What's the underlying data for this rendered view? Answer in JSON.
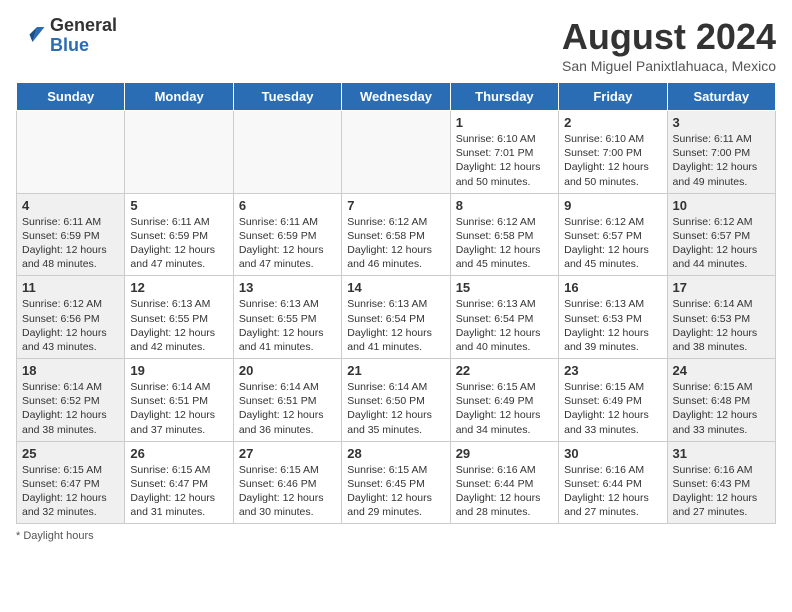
{
  "logo": {
    "general": "General",
    "blue": "Blue"
  },
  "title": "August 2024",
  "subtitle": "San Miguel Panixtlahuaca, Mexico",
  "days": [
    "Sunday",
    "Monday",
    "Tuesday",
    "Wednesday",
    "Thursday",
    "Friday",
    "Saturday"
  ],
  "weeks": [
    [
      {
        "day": "",
        "content": ""
      },
      {
        "day": "",
        "content": ""
      },
      {
        "day": "",
        "content": ""
      },
      {
        "day": "",
        "content": ""
      },
      {
        "day": "1",
        "content": "Sunrise: 6:10 AM\nSunset: 7:01 PM\nDaylight: 12 hours\nand 50 minutes."
      },
      {
        "day": "2",
        "content": "Sunrise: 6:10 AM\nSunset: 7:00 PM\nDaylight: 12 hours\nand 50 minutes."
      },
      {
        "day": "3",
        "content": "Sunrise: 6:11 AM\nSunset: 7:00 PM\nDaylight: 12 hours\nand 49 minutes."
      }
    ],
    [
      {
        "day": "4",
        "content": "Sunrise: 6:11 AM\nSunset: 6:59 PM\nDaylight: 12 hours\nand 48 minutes."
      },
      {
        "day": "5",
        "content": "Sunrise: 6:11 AM\nSunset: 6:59 PM\nDaylight: 12 hours\nand 47 minutes."
      },
      {
        "day": "6",
        "content": "Sunrise: 6:11 AM\nSunset: 6:59 PM\nDaylight: 12 hours\nand 47 minutes."
      },
      {
        "day": "7",
        "content": "Sunrise: 6:12 AM\nSunset: 6:58 PM\nDaylight: 12 hours\nand 46 minutes."
      },
      {
        "day": "8",
        "content": "Sunrise: 6:12 AM\nSunset: 6:58 PM\nDaylight: 12 hours\nand 45 minutes."
      },
      {
        "day": "9",
        "content": "Sunrise: 6:12 AM\nSunset: 6:57 PM\nDaylight: 12 hours\nand 45 minutes."
      },
      {
        "day": "10",
        "content": "Sunrise: 6:12 AM\nSunset: 6:57 PM\nDaylight: 12 hours\nand 44 minutes."
      }
    ],
    [
      {
        "day": "11",
        "content": "Sunrise: 6:12 AM\nSunset: 6:56 PM\nDaylight: 12 hours\nand 43 minutes."
      },
      {
        "day": "12",
        "content": "Sunrise: 6:13 AM\nSunset: 6:55 PM\nDaylight: 12 hours\nand 42 minutes."
      },
      {
        "day": "13",
        "content": "Sunrise: 6:13 AM\nSunset: 6:55 PM\nDaylight: 12 hours\nand 41 minutes."
      },
      {
        "day": "14",
        "content": "Sunrise: 6:13 AM\nSunset: 6:54 PM\nDaylight: 12 hours\nand 41 minutes."
      },
      {
        "day": "15",
        "content": "Sunrise: 6:13 AM\nSunset: 6:54 PM\nDaylight: 12 hours\nand 40 minutes."
      },
      {
        "day": "16",
        "content": "Sunrise: 6:13 AM\nSunset: 6:53 PM\nDaylight: 12 hours\nand 39 minutes."
      },
      {
        "day": "17",
        "content": "Sunrise: 6:14 AM\nSunset: 6:53 PM\nDaylight: 12 hours\nand 38 minutes."
      }
    ],
    [
      {
        "day": "18",
        "content": "Sunrise: 6:14 AM\nSunset: 6:52 PM\nDaylight: 12 hours\nand 38 minutes."
      },
      {
        "day": "19",
        "content": "Sunrise: 6:14 AM\nSunset: 6:51 PM\nDaylight: 12 hours\nand 37 minutes."
      },
      {
        "day": "20",
        "content": "Sunrise: 6:14 AM\nSunset: 6:51 PM\nDaylight: 12 hours\nand 36 minutes."
      },
      {
        "day": "21",
        "content": "Sunrise: 6:14 AM\nSunset: 6:50 PM\nDaylight: 12 hours\nand 35 minutes."
      },
      {
        "day": "22",
        "content": "Sunrise: 6:15 AM\nSunset: 6:49 PM\nDaylight: 12 hours\nand 34 minutes."
      },
      {
        "day": "23",
        "content": "Sunrise: 6:15 AM\nSunset: 6:49 PM\nDaylight: 12 hours\nand 33 minutes."
      },
      {
        "day": "24",
        "content": "Sunrise: 6:15 AM\nSunset: 6:48 PM\nDaylight: 12 hours\nand 33 minutes."
      }
    ],
    [
      {
        "day": "25",
        "content": "Sunrise: 6:15 AM\nSunset: 6:47 PM\nDaylight: 12 hours\nand 32 minutes."
      },
      {
        "day": "26",
        "content": "Sunrise: 6:15 AM\nSunset: 6:47 PM\nDaylight: 12 hours\nand 31 minutes."
      },
      {
        "day": "27",
        "content": "Sunrise: 6:15 AM\nSunset: 6:46 PM\nDaylight: 12 hours\nand 30 minutes."
      },
      {
        "day": "28",
        "content": "Sunrise: 6:15 AM\nSunset: 6:45 PM\nDaylight: 12 hours\nand 29 minutes."
      },
      {
        "day": "29",
        "content": "Sunrise: 6:16 AM\nSunset: 6:44 PM\nDaylight: 12 hours\nand 28 minutes."
      },
      {
        "day": "30",
        "content": "Sunrise: 6:16 AM\nSunset: 6:44 PM\nDaylight: 12 hours\nand 27 minutes."
      },
      {
        "day": "31",
        "content": "Sunrise: 6:16 AM\nSunset: 6:43 PM\nDaylight: 12 hours\nand 27 minutes."
      }
    ]
  ],
  "footnote": "Daylight hours"
}
